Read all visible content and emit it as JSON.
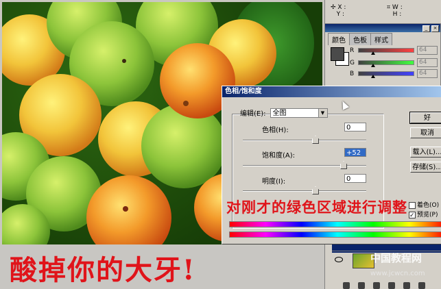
{
  "info": {
    "xy_label": "X :\nY :",
    "wh_label": "W :\nH :"
  },
  "color_palette": {
    "tabs": [
      "颜色",
      "色板",
      "样式"
    ],
    "channels": [
      {
        "name": "R",
        "value": "64",
        "color": "#e02020",
        "level": 0.25
      },
      {
        "name": "G",
        "value": "64",
        "color": "#20a020",
        "level": 0.25
      },
      {
        "name": "B",
        "value": "64",
        "color": "#2020e0",
        "level": 0.25
      }
    ]
  },
  "dialog": {
    "title": "色相/饱和度",
    "edit_label": "编辑(E):",
    "edit_value": "全图",
    "hue": {
      "label": "色相(H):",
      "value": "0",
      "level": 0.5
    },
    "saturation": {
      "label": "饱和度(A):",
      "value": "+52",
      "level": 0.76
    },
    "lightness": {
      "label": "明度(I):",
      "value": "0",
      "level": 0.5
    },
    "buttons": {
      "ok": "好",
      "cancel": "取消",
      "load": "载入(L)...",
      "save": "存储(S)..."
    },
    "colorize_label": "着色(O)",
    "preview_label": "预览(P)"
  },
  "overlay_text": "对刚才的绿色区域进行调整",
  "caption": "酸掉你的大牙!",
  "watermark": {
    "text": "中国教程网",
    "url": "www.jcwcn.com"
  },
  "colors": {
    "caption_red": "#e0141a",
    "title_blue": "#0a246a",
    "panel_gray": "#d4d0c8"
  }
}
